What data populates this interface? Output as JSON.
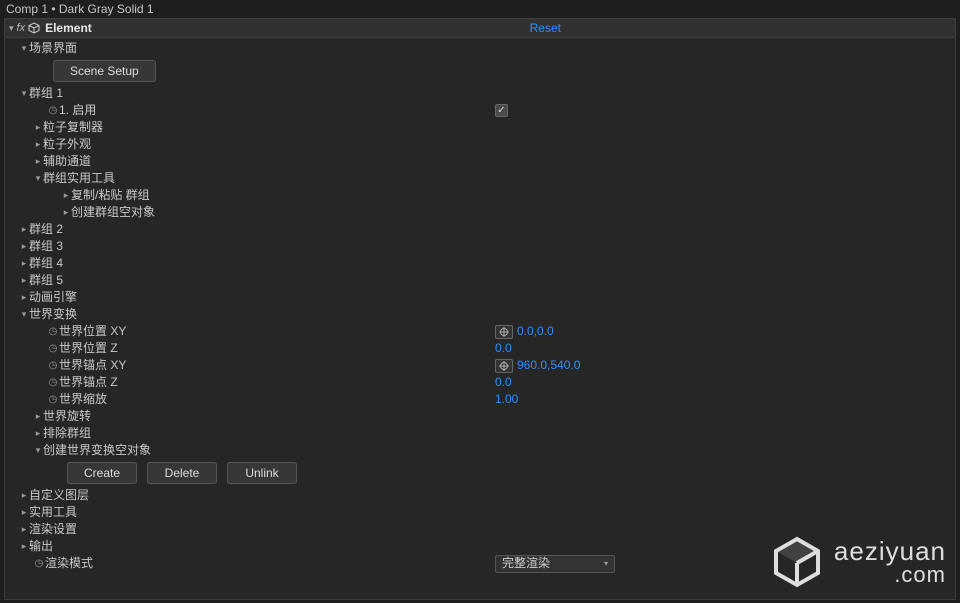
{
  "title": "Comp 1 • Dark Gray Solid 1",
  "effect": {
    "name": "Element",
    "reset": "Reset"
  },
  "sceneInterface": {
    "label": "场景界面",
    "sceneSetupBtn": "Scene Setup"
  },
  "group1": {
    "label": "群组 1",
    "enable": "1. 启用",
    "particleReplicator": "粒子复制器",
    "particleLook": "粒子外观",
    "auxChannel": "辅助通道",
    "groupUtils": {
      "label": "群组实用工具",
      "copyPaste": "复制/粘贴 群组",
      "createNull": "创建群组空对象"
    }
  },
  "group2": "群组 2",
  "group3": "群组 3",
  "group4": "群组 4",
  "group5": "群组 5",
  "animEngine": "动画引擎",
  "worldTransform": {
    "label": "世界变换",
    "posXY": {
      "label": "世界位置 XY",
      "value": "0.0,0.0"
    },
    "posZ": {
      "label": "世界位置 Z",
      "value": "0.0"
    },
    "anchorXY": {
      "label": "世界锚点 XY",
      "value": "960.0,540.0"
    },
    "anchorZ": {
      "label": "世界锚点 Z",
      "value": "0.0"
    },
    "scale": {
      "label": "世界缩放",
      "value": "1.00"
    },
    "rotation": "世界旋转",
    "excludeGroup": "排除群组",
    "createNull": {
      "label": "创建世界变换空对象",
      "create": "Create",
      "delete": "Delete",
      "unlink": "Unlink"
    }
  },
  "customLayer": "自定义图层",
  "utils": "实用工具",
  "renderSettings": "渲染设置",
  "output": "输出",
  "renderMode": {
    "label": "渲染模式",
    "value": "完整渲染"
  },
  "watermark": {
    "line1": "aeziyuan",
    "line2": ".com"
  }
}
